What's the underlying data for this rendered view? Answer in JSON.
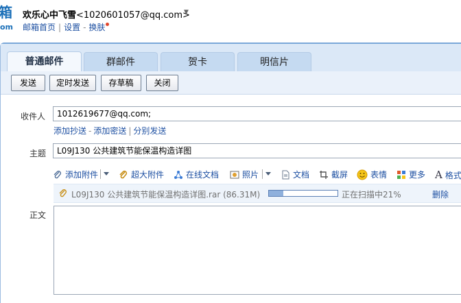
{
  "header": {
    "logo_fragment": "箱",
    "logo_fragment2": "om",
    "user_name": "欢乐心中飞雪",
    "user_email": "<1020601057@qq.com>",
    "links": [
      "邮箱首页",
      "设置",
      "换肤"
    ]
  },
  "tabs": [
    {
      "label": "普通邮件",
      "active": true
    },
    {
      "label": "群邮件",
      "active": false
    },
    {
      "label": "贺卡",
      "active": false
    },
    {
      "label": "明信片",
      "active": false
    }
  ],
  "toolbar": {
    "send": "发送",
    "scheduled_send": "定时发送",
    "save_draft": "存草稿",
    "close": "关闭"
  },
  "compose": {
    "to_label": "收件人",
    "to_value": "1012619677@qq.com;",
    "cc_link": "添加抄送",
    "bcc_link": "添加密送",
    "separate_link": "分别发送",
    "subject_label": "主题",
    "subject_value": "L09J130 公共建筑节能保温构造详图",
    "body_label": "正文"
  },
  "attach_toolbar": {
    "add_attachment": "添加附件",
    "large_attachment": "超大附件",
    "online_doc": "在线文档",
    "photo": "照片",
    "document": "文档",
    "screenshot": "截屏",
    "emoji": "表情",
    "more": "更多",
    "format": "格式"
  },
  "upload": {
    "file_name": "L09J130 公共建筑节能保温构造详图.rar",
    "file_size": "(86.31M)",
    "progress": 0.21,
    "status": "正在扫描中21%",
    "delete": "删除"
  },
  "colors": {
    "link": "#1e50a2",
    "tab_bar": "#dbe8f7",
    "accent": "#1a6fb8",
    "badge": "#e0452a"
  }
}
